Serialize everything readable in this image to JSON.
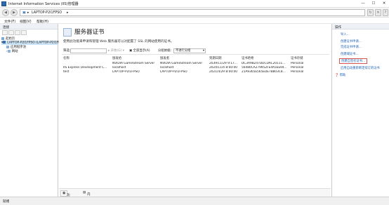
{
  "window": {
    "title": "Internet Information Services (IIS)管理器",
    "minimize": "—",
    "maximize": "☐",
    "close": "✕"
  },
  "address": {
    "root_sep": "▸",
    "host": "LAPTOP-P2I1FPSO",
    "sep": "▸"
  },
  "menu": [
    "文件(F)",
    "视图(V)",
    "帮助(H)"
  ],
  "connections": {
    "header": "连接",
    "tree": [
      {
        "label": "起始页"
      },
      {
        "label": "LAPTOP-P2I1FPSO (LAPTOP-P2I1FPSO\\...)"
      },
      {
        "label": "应用程序池"
      },
      {
        "label": "网站"
      }
    ]
  },
  "center": {
    "title": "服务器证书",
    "description": "使用此功能来申请和管理 Web 服务器可以对配置了 SSL 的网站使用的证书。",
    "toolbar": {
      "filter_label": "筛选:",
      "go": "开始(G)",
      "show_all": "全部显示(A)",
      "group_by": "分组依据:",
      "group_value": "不进行分组"
    },
    "columns": [
      "名称",
      "颁发给",
      "颁发者",
      "到期日期",
      "证书哈希",
      "证书存储"
    ],
    "rows": [
      [
        "",
        "NVIDIA GameStream Server",
        "NVIDIA GameStream Server",
        "2039/11/29 9:17...",
        "DC3A9B247DDCDAC20111...",
        "Personal"
      ],
      [
        "IIS Express Development C...",
        "localhost",
        "localhost",
        "2024/11/4 8:00:00",
        "56480CA279952FE4A5EE94...",
        "Personal"
      ],
      [
        "test",
        "LAPTOP-P2I1FPSO",
        "LAPTOP-P2I1FPSO",
        "2021/4/29 8:00:00",
        "21A9365E565EDE7B803C8...",
        "Personal"
      ]
    ],
    "view_tabs": {
      "features": "功能视图",
      "content": "内容视图"
    }
  },
  "actions": {
    "header": "操作",
    "items": [
      "导入...",
      "创建证书申请...",
      "完成证书申请...",
      "创建域证书...",
      "创建自签名证书...",
      "启用自动重新绑定续订的证书",
      "帮助"
    ]
  },
  "status": {
    "text": "就绪"
  },
  "colors": {
    "accent": "#1a5fb4",
    "highlight_border": "#d9534f",
    "selection": "#cce4f7"
  }
}
